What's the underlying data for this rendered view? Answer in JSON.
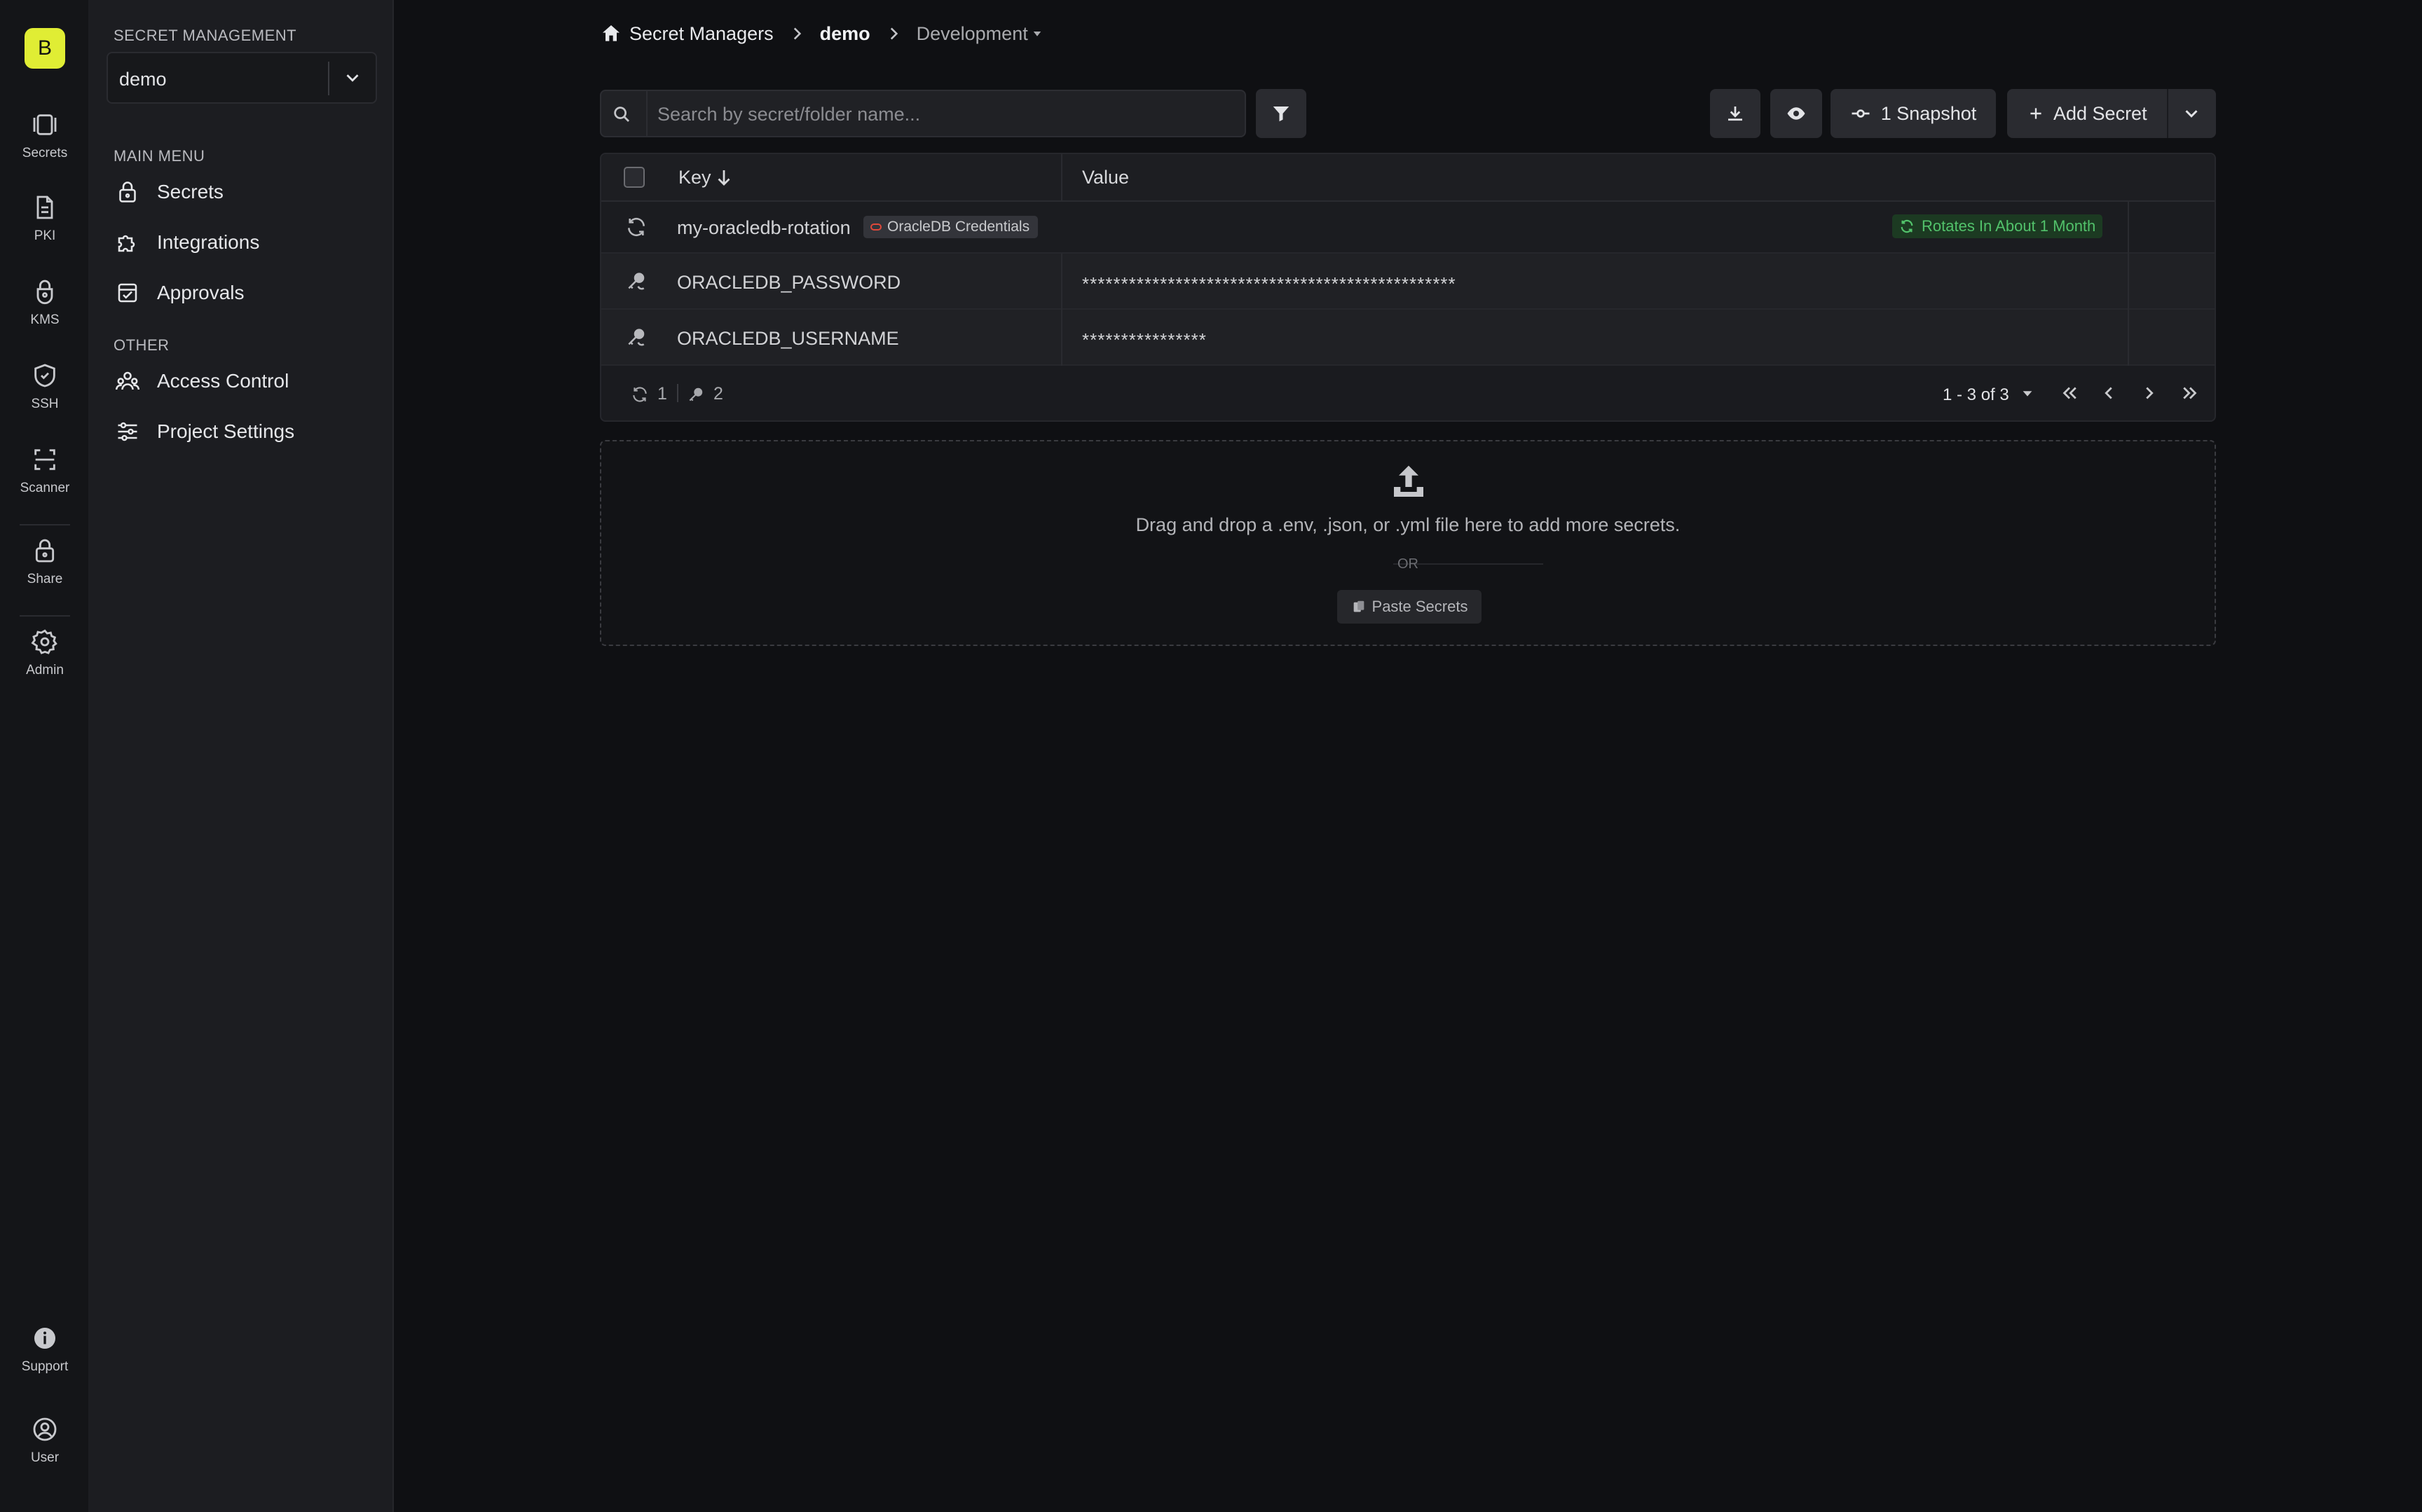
{
  "org": {
    "initial": "B"
  },
  "rail": {
    "items": [
      {
        "label": "Secrets",
        "icon": "secrets-icon"
      },
      {
        "label": "PKI",
        "icon": "document-icon"
      },
      {
        "label": "KMS",
        "icon": "kms-lock-icon"
      },
      {
        "label": "SSH",
        "icon": "shield-icon"
      },
      {
        "label": "Scanner",
        "icon": "scan-icon"
      },
      {
        "label": "Share",
        "icon": "lock-icon"
      },
      {
        "label": "Admin",
        "icon": "gear-icon"
      }
    ],
    "bottom": [
      {
        "label": "Support",
        "icon": "info-icon"
      },
      {
        "label": "User",
        "icon": "user-icon"
      }
    ]
  },
  "sidebar": {
    "section_title": "SECRET MANAGEMENT",
    "project": "demo",
    "main_menu_title": "MAIN MENU",
    "main_menu": [
      {
        "label": "Secrets",
        "icon": "lock-icon"
      },
      {
        "label": "Integrations",
        "icon": "puzzle-icon"
      },
      {
        "label": "Approvals",
        "icon": "approval-icon"
      }
    ],
    "other_title": "OTHER",
    "other": [
      {
        "label": "Access Control",
        "icon": "users-icon"
      },
      {
        "label": "Project Settings",
        "icon": "sliders-icon"
      }
    ]
  },
  "breadcrumb": {
    "root": "Secret Managers",
    "project": "demo",
    "environment": "Development"
  },
  "toolbar": {
    "search_placeholder": "Search by secret/folder name...",
    "snapshot_label": "1 Snapshot",
    "add_secret_label": "Add Secret"
  },
  "table": {
    "columns": {
      "key": "Key",
      "value": "Value"
    },
    "rotation": {
      "name": "my-oracledb-rotation",
      "tag": "OracleDB Credentials",
      "status": "Rotates In About 1 Month"
    },
    "rows": [
      {
        "key": "ORACLEDB_PASSWORD",
        "value": "************************************************"
      },
      {
        "key": "ORACLEDB_USERNAME",
        "value": "****************"
      }
    ],
    "footer": {
      "rotation_count": "1",
      "secret_count": "2",
      "range": "1 - 3 of 3"
    }
  },
  "dropzone": {
    "message": "Drag and drop a .env, .json, or .yml file here to add more secrets.",
    "or": "OR",
    "paste_label": "Paste Secrets"
  },
  "colors": {
    "background": "#0f1013",
    "accent_badge": "#e0ed34",
    "rotation_green": "#52c26b",
    "oracle_red": "#e0493a"
  }
}
